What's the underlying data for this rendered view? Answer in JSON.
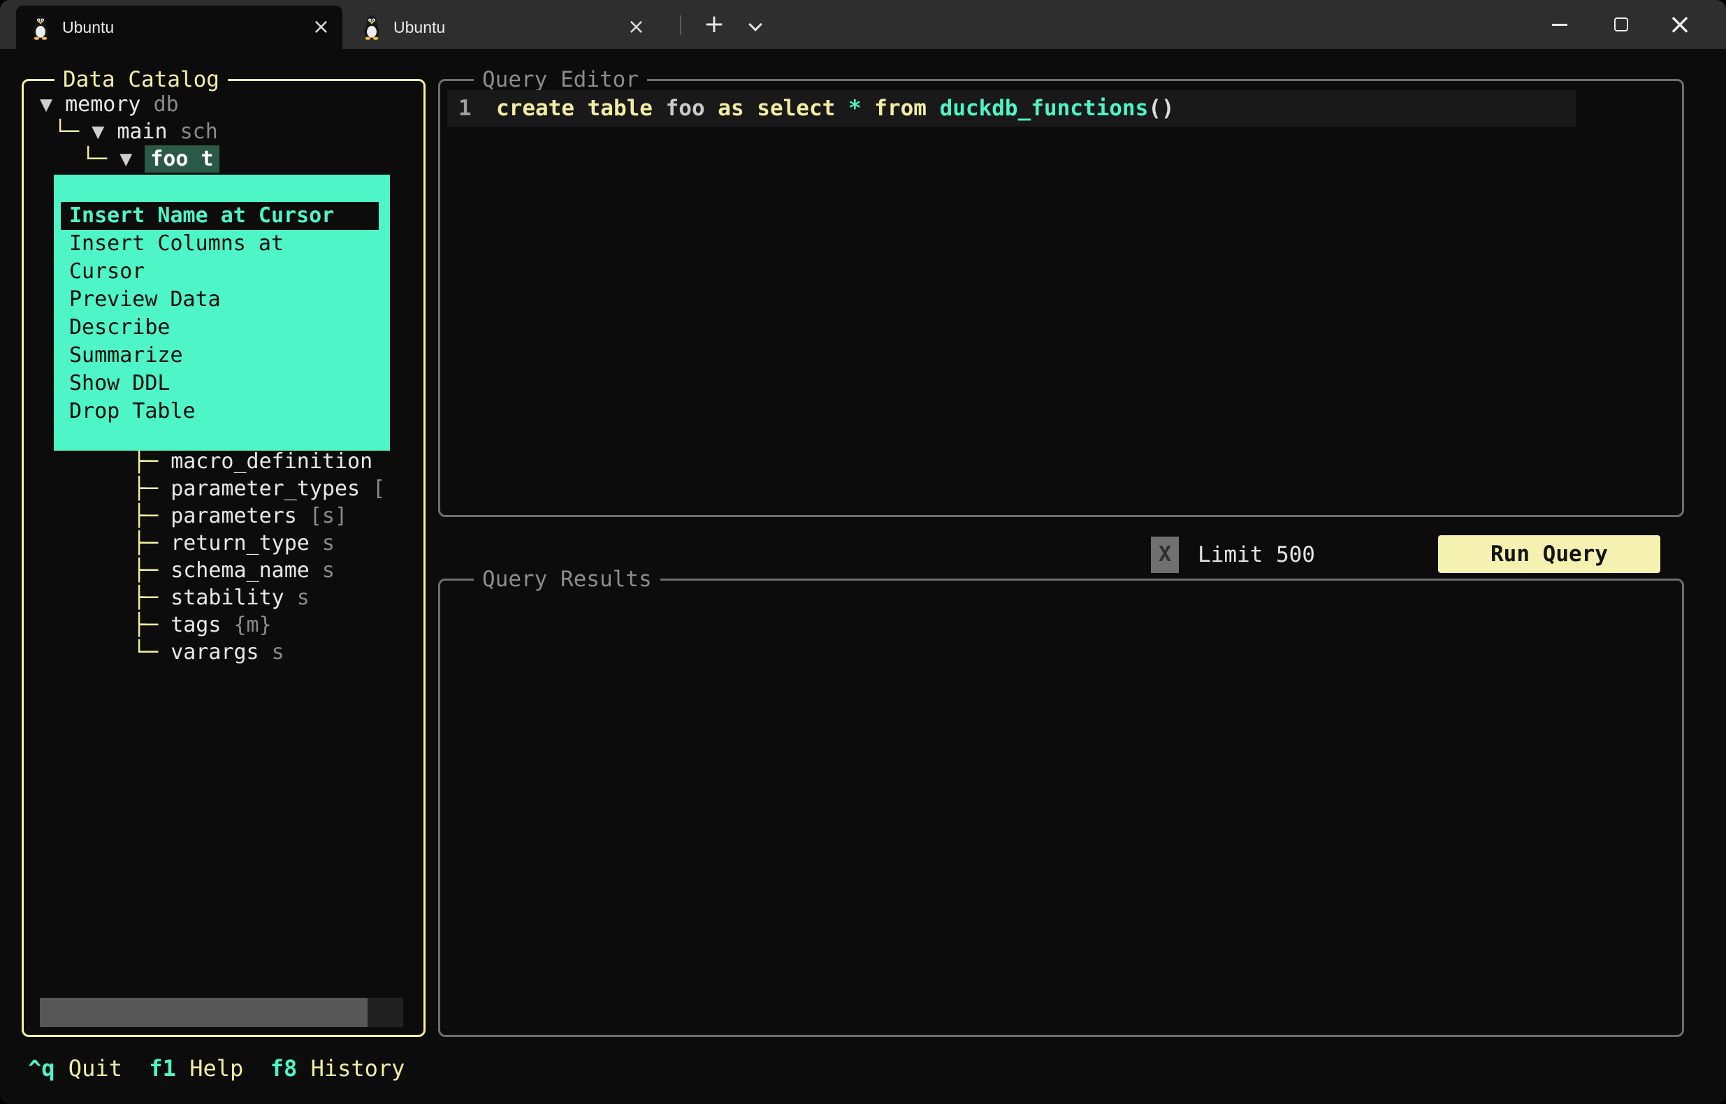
{
  "colors": {
    "terminal_bg": "#0C0C0C",
    "titlebar_bg": "#2E2E2E",
    "accent_yellow": "#F5F0A0",
    "accent_mint": "#4DF5C7",
    "selected_node_green": "#2A5948",
    "panel_border_gray": "#6E6E6E"
  },
  "titlebar": {
    "tabs": [
      {
        "label": "Ubuntu"
      },
      {
        "label": "Ubuntu"
      }
    ],
    "new_tab": "+",
    "close_glyph": "×"
  },
  "catalog": {
    "title": "Data Catalog",
    "tree": [
      {
        "prefix": "",
        "arrow": "▼",
        "label": "memory",
        "type": "db",
        "selected": false
      },
      {
        "prefix": "└─",
        "arrow": "▼",
        "label": "main",
        "type": "sch",
        "selected": false
      },
      {
        "prefix": "└─",
        "arrow": "▼",
        "label": "foo",
        "type": "t",
        "selected": true
      }
    ],
    "columns": [
      {
        "connector": "├─ ",
        "name": "macro_definition",
        "type": ""
      },
      {
        "connector": "├─ ",
        "name": "parameter_types",
        "type": "["
      },
      {
        "connector": "├─ ",
        "name": "parameters",
        "type": "[s]"
      },
      {
        "connector": "├─ ",
        "name": "return_type",
        "type": "s"
      },
      {
        "connector": "├─ ",
        "name": "schema_name",
        "type": "s"
      },
      {
        "connector": "├─ ",
        "name": "stability",
        "type": "s"
      },
      {
        "connector": "├─ ",
        "name": "tags",
        "type": "{m}"
      },
      {
        "connector": "└─ ",
        "name": "varargs",
        "type": "s"
      }
    ]
  },
  "context_menu": {
    "selected_index": 0,
    "items": [
      "Insert Name at Cursor",
      "Insert Columns at Cursor",
      "Preview Data",
      "Describe",
      "Summarize",
      "Show DDL",
      "Drop Table"
    ]
  },
  "editor": {
    "title": "Query Editor",
    "line_number": "1",
    "tokens": [
      {
        "text": "create table ",
        "style": "kw"
      },
      {
        "text": "foo ",
        "style": "plain"
      },
      {
        "text": "as select ",
        "style": "kw"
      },
      {
        "text": "*",
        "style": "mint"
      },
      {
        "text": " ",
        "style": "plain"
      },
      {
        "text": "from ",
        "style": "kw"
      },
      {
        "text": "duckdb_functions",
        "style": "mint-bold"
      },
      {
        "text": "()",
        "style": "paren"
      }
    ]
  },
  "run_bar": {
    "checkbox_glyph": "X",
    "limit_label": "Limit 500",
    "run_button": "Run Query"
  },
  "results": {
    "title": "Query Results"
  },
  "footer": [
    {
      "key": "^q",
      "label": "Quit"
    },
    {
      "key": "f1",
      "label": "Help"
    },
    {
      "key": "f8",
      "label": "History"
    }
  ]
}
